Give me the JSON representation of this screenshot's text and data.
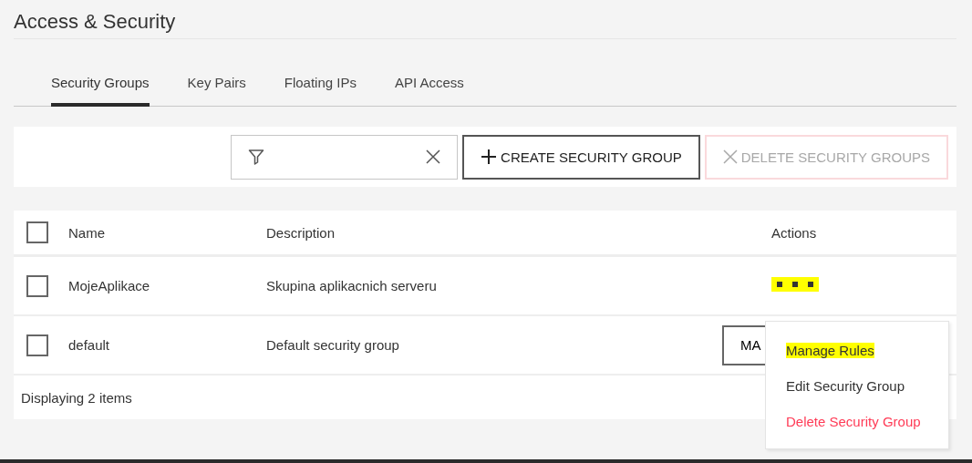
{
  "page_title": "Access & Security",
  "tabs": [
    {
      "label": "Security Groups",
      "selected": true
    },
    {
      "label": "Key Pairs",
      "selected": false
    },
    {
      "label": "Floating IPs",
      "selected": false
    },
    {
      "label": "API Access",
      "selected": false
    }
  ],
  "toolbar": {
    "create_button": {
      "label": "CREATE SECURITY GROUP"
    },
    "delete_button": {
      "label": "DELETE SECURITY GROUPS",
      "disabled": true
    }
  },
  "table": {
    "columns": [
      "Name",
      "Description",
      "Actions"
    ],
    "select_all_checked": false,
    "rows": [
      {
        "checked": false,
        "name": "MojeAplikace",
        "description": "Skupina aplikacnich serveru",
        "action": {
          "kind": "more",
          "highlighted": true
        }
      },
      {
        "checked": false,
        "name": "default",
        "description": "Default security group",
        "action": {
          "kind": "button",
          "label": "MA"
        }
      }
    ],
    "footer": "Displaying 2 items"
  },
  "action_menu": {
    "items": [
      {
        "label": "Manage Rules",
        "kind": "normal",
        "highlighted": true
      },
      {
        "label": "Edit Security Group",
        "kind": "normal",
        "highlighted": false
      },
      {
        "label": "Delete Security Group",
        "kind": "danger",
        "highlighted": false
      }
    ]
  }
}
